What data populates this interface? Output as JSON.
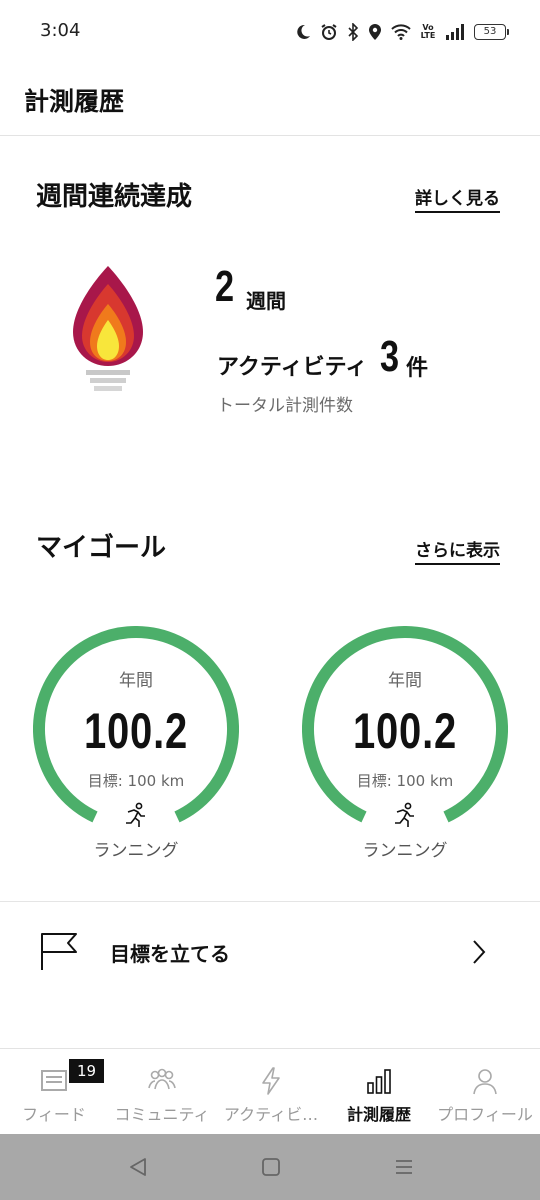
{
  "status_bar": {
    "time": "3:04",
    "battery": "53",
    "network_label": "Vo LTE"
  },
  "header": {
    "title": "計測履歴"
  },
  "weekly_streak": {
    "title": "週間連続達成",
    "link": "詳しく見る",
    "weeks_value": "2",
    "weeks_unit": "週間",
    "activity_label": "アクティビティ",
    "activity_value": "3",
    "activity_unit": "件",
    "subtitle": "トータル計測件数"
  },
  "my_goals": {
    "title": "マイゴール",
    "link": "さらに表示",
    "accent_color": "#4caf6a",
    "goals": [
      {
        "period": "年間",
        "value": "100.2",
        "target": "目標: 100 km",
        "type": "ランニング",
        "progress": 1.0
      },
      {
        "period": "年間",
        "value": "100.2",
        "target": "目標: 100 km",
        "type": "ランニング",
        "progress": 1.0
      }
    ]
  },
  "set_goal": {
    "label": "目標を立てる"
  },
  "bottom_nav": {
    "items": [
      {
        "label": "フィード",
        "icon": "feed-icon",
        "badge": "19"
      },
      {
        "label": "コミュニティ",
        "icon": "community-icon"
      },
      {
        "label": "アクティビ…",
        "icon": "activity-bolt-icon"
      },
      {
        "label": "計測履歴",
        "icon": "stats-bars-icon",
        "active": true
      },
      {
        "label": "プロフィール",
        "icon": "profile-icon"
      }
    ]
  }
}
